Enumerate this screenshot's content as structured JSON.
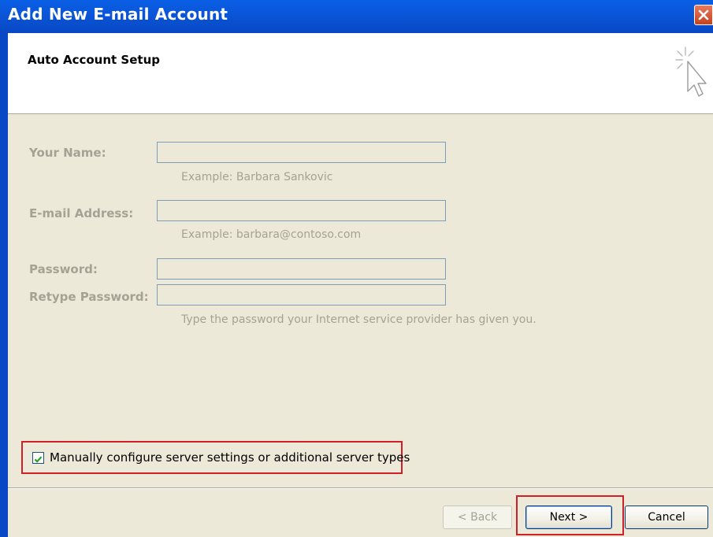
{
  "window": {
    "title": "Add New E-mail Account"
  },
  "header": {
    "heading": "Auto Account Setup"
  },
  "form": {
    "name_label": "Your Name:",
    "name_value": "",
    "name_hint": "Example: Barbara Sankovic",
    "email_label": "E-mail Address:",
    "email_value": "",
    "email_hint": "Example: barbara@contoso.com",
    "password_label": "Password:",
    "retype_label": "Retype Password:",
    "password_hint": "Type the password your Internet service provider has given you."
  },
  "manual_config": {
    "label": "Manually configure server settings or additional server types",
    "checked": true
  },
  "buttons": {
    "back": "< Back",
    "next": "Next >",
    "cancel": "Cancel"
  },
  "colors": {
    "titlebar": "#0a56d9",
    "highlight": "#d01f26",
    "dialog_bg": "#ece9d8"
  }
}
